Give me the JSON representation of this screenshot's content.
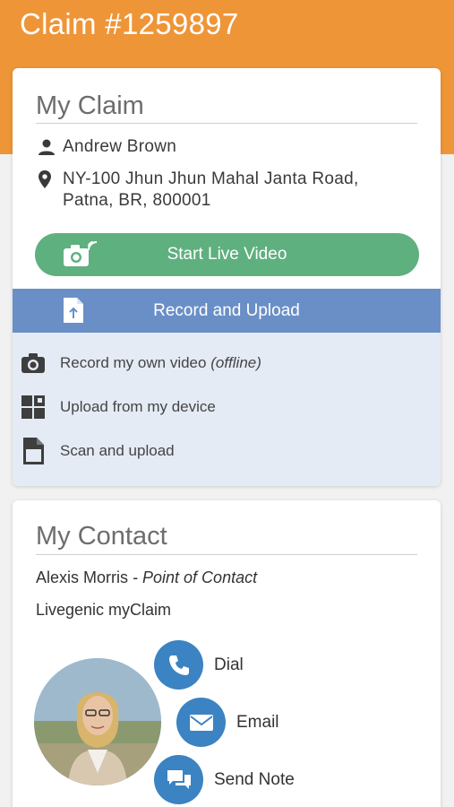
{
  "header": {
    "title": "Claim #1259897"
  },
  "claim": {
    "section_title": "My Claim",
    "name": "Andrew Brown",
    "address_line1": "NY-100 Jhun Jhun Mahal Janta Road,",
    "address_line2": "Patna, BR, 800001",
    "live_video_label": "Start Live Video",
    "record_upload_label": "Record and Upload",
    "options": [
      {
        "label": "Record my own video",
        "note": "(offline)",
        "icon": "camera-icon"
      },
      {
        "label": "Upload from my device",
        "icon": "grid-icon"
      },
      {
        "label": "Scan and upload",
        "icon": "scan-document-icon"
      }
    ]
  },
  "contact": {
    "section_title": "My Contact",
    "name": "Alexis Morris",
    "role": " - Point of Contact",
    "company": "Livegenic myClaim",
    "actions": [
      {
        "label": "Dial",
        "icon": "phone-icon"
      },
      {
        "label": "Email",
        "icon": "envelope-icon"
      },
      {
        "label": "Send Note",
        "icon": "chat-icon"
      }
    ]
  },
  "colors": {
    "header": "#ee9538",
    "live_button": "#5fb07f",
    "upload_button": "#6a8fc7",
    "options_bg": "#e4ebf5",
    "action_circle": "#3b83c2"
  }
}
